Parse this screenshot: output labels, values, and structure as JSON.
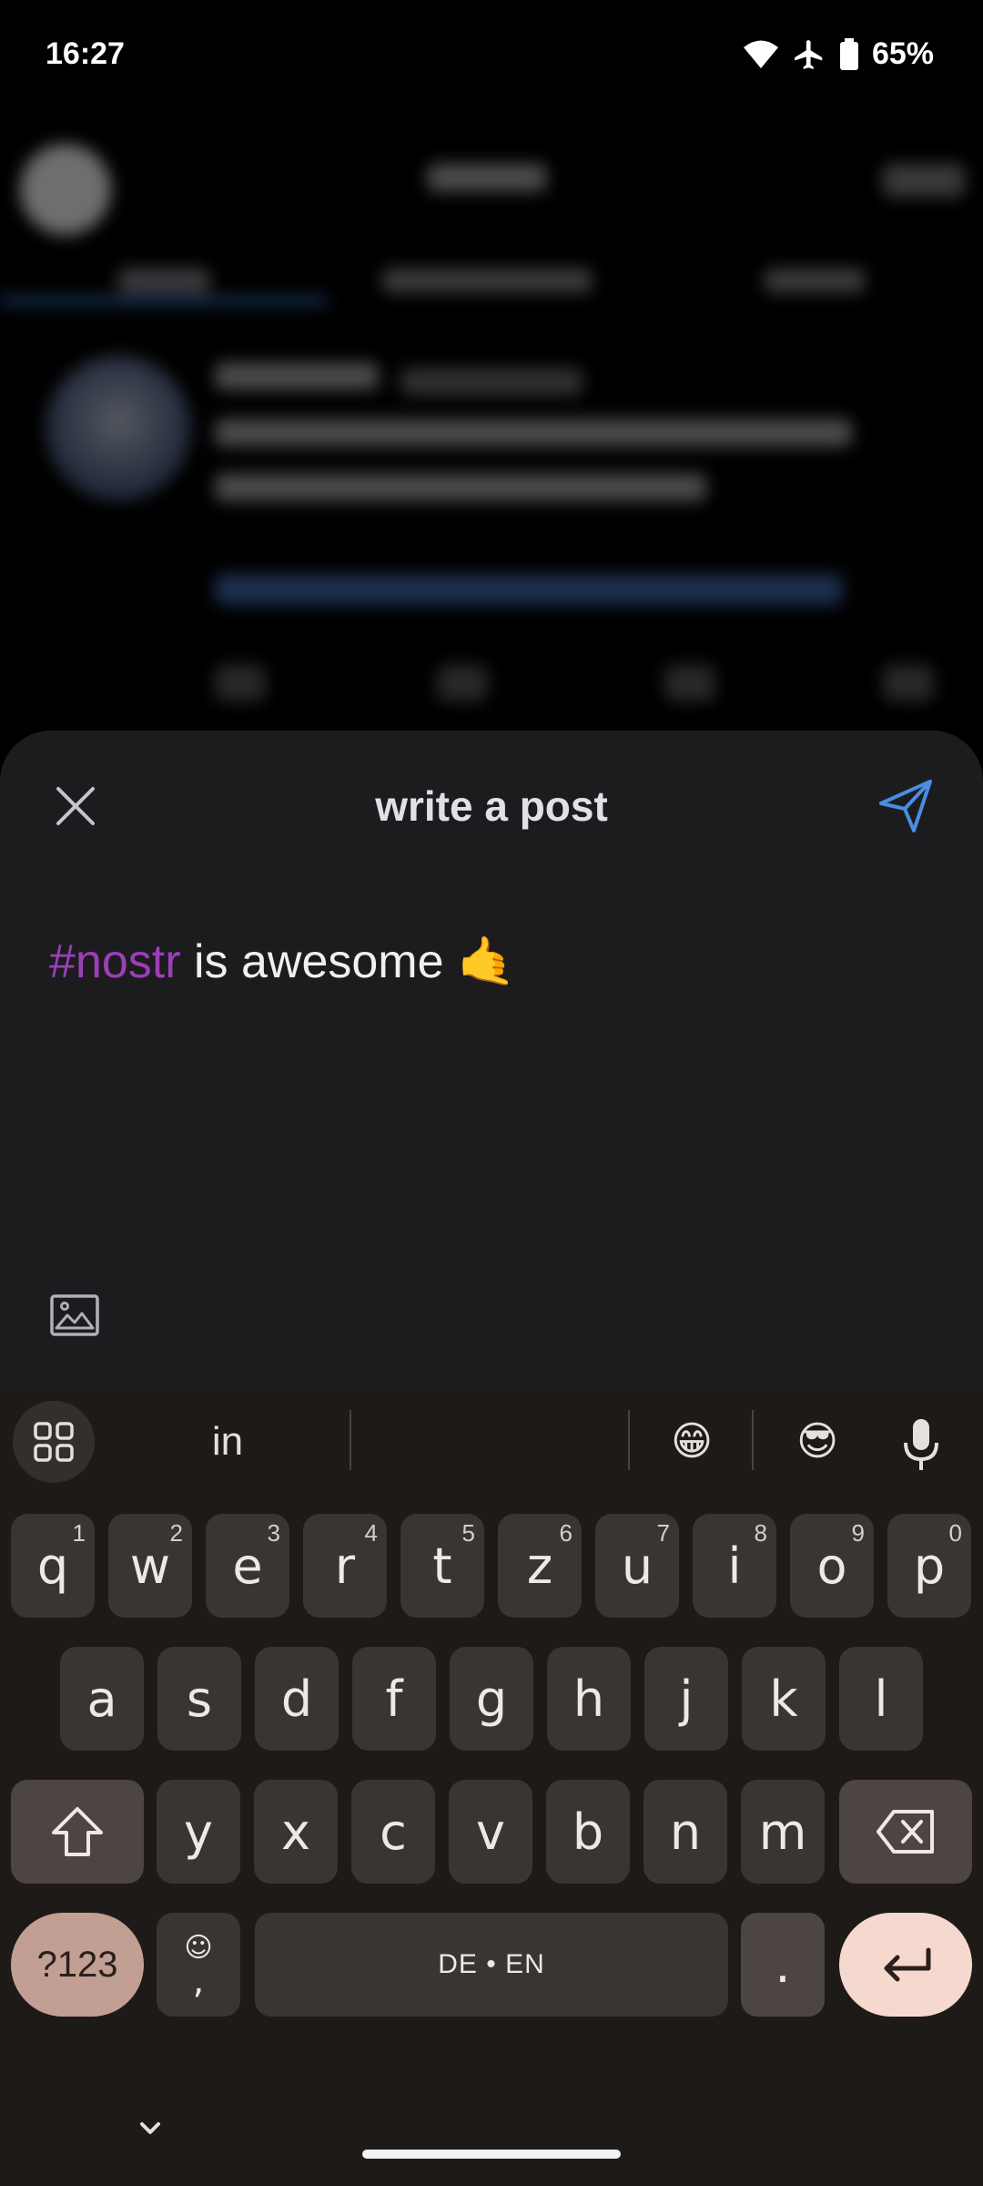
{
  "status_bar": {
    "time": "16:27",
    "battery": "65%",
    "icons": [
      "wifi-icon",
      "airplane-icon",
      "battery-icon"
    ]
  },
  "compose": {
    "title": "write a post",
    "hashtag": "#nostr",
    "body_text": " is awesome ",
    "emoji": "🤙",
    "accent_color": "#4a8ee0",
    "hashtag_color": "#9b3fb8"
  },
  "keyboard": {
    "suggestion_word": "in",
    "suggestion_emoji_1": "😁",
    "suggestion_emoji_2": "😎",
    "row1": [
      {
        "label": "q",
        "hint": "1"
      },
      {
        "label": "w",
        "hint": "2"
      },
      {
        "label": "e",
        "hint": "3"
      },
      {
        "label": "r",
        "hint": "4"
      },
      {
        "label": "t",
        "hint": "5"
      },
      {
        "label": "z",
        "hint": "6"
      },
      {
        "label": "u",
        "hint": "7"
      },
      {
        "label": "i",
        "hint": "8"
      },
      {
        "label": "o",
        "hint": "9"
      },
      {
        "label": "p",
        "hint": "0"
      }
    ],
    "row2": [
      "a",
      "s",
      "d",
      "f",
      "g",
      "h",
      "j",
      "k",
      "l"
    ],
    "row3": [
      "y",
      "x",
      "c",
      "v",
      "b",
      "n",
      "m"
    ],
    "symbols_label": "?123",
    "emoji_key_top": "☺",
    "comma": ",",
    "space_label": "DE • EN",
    "period": "."
  }
}
